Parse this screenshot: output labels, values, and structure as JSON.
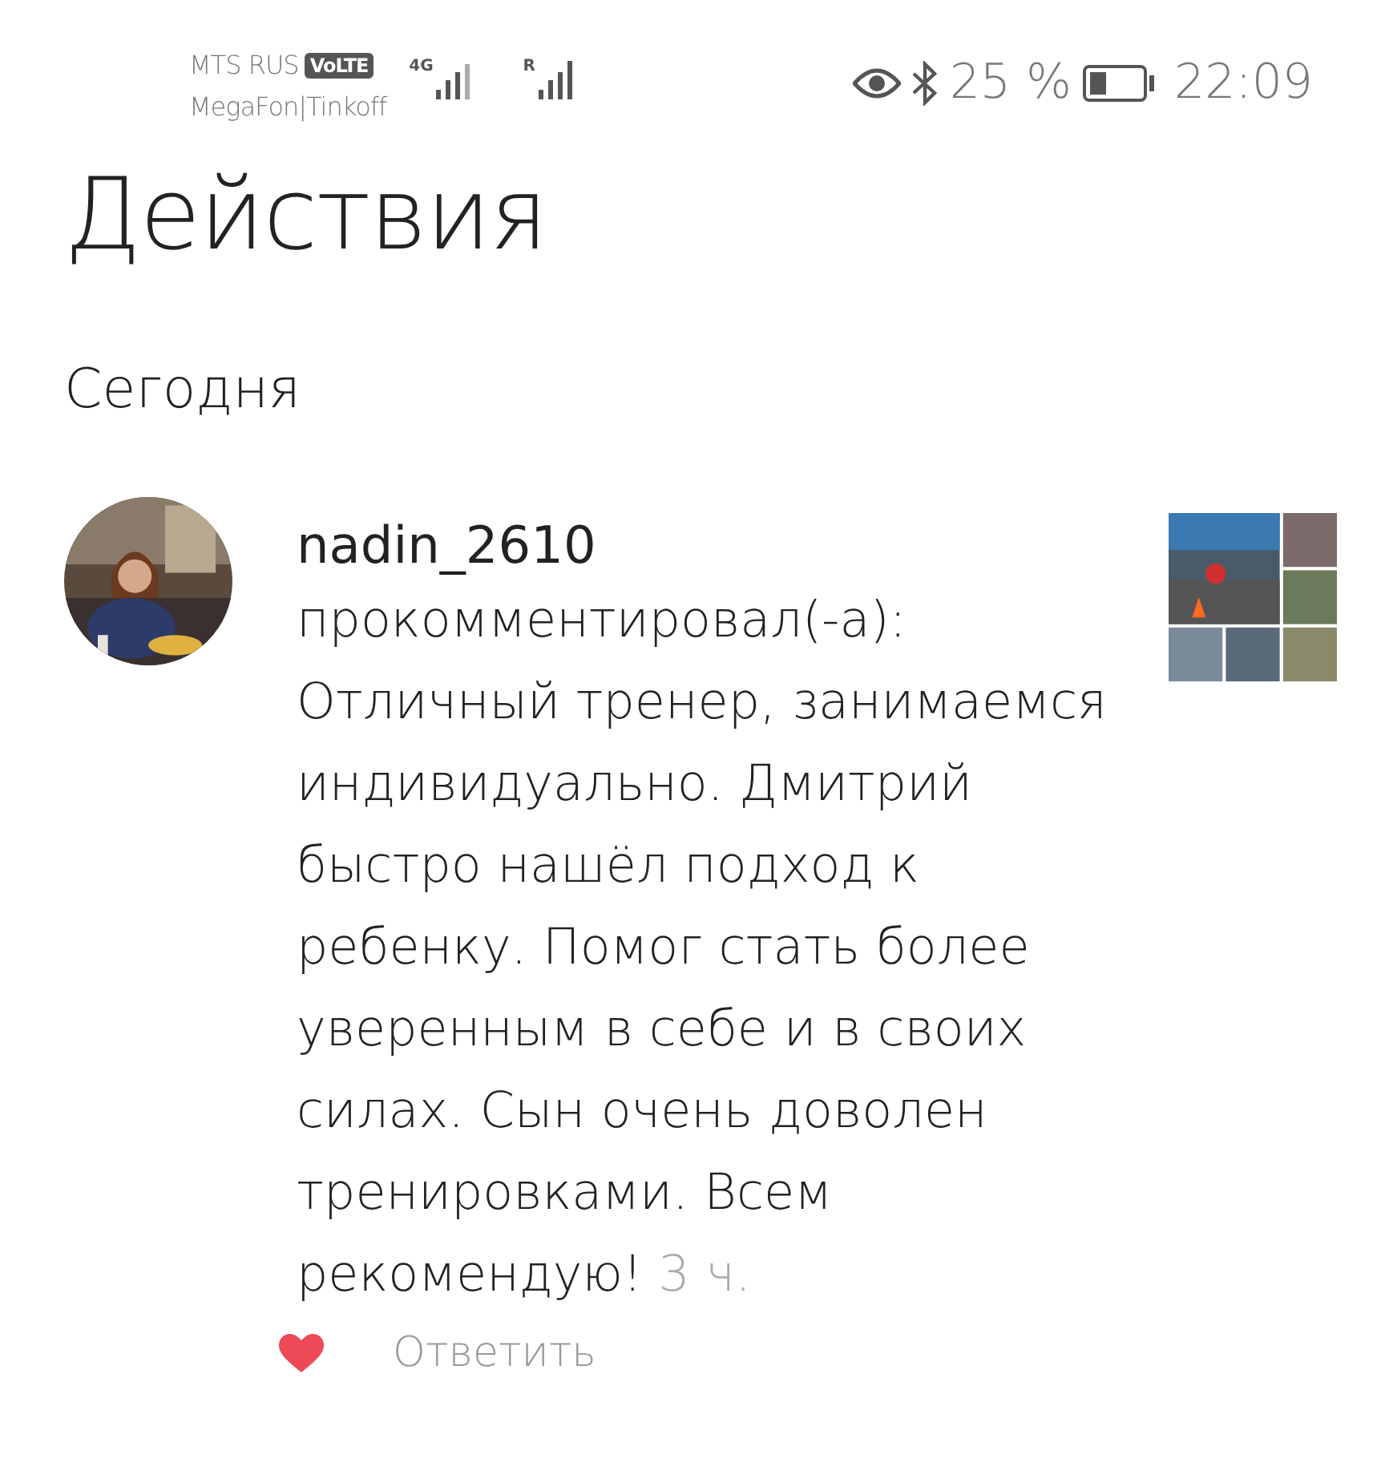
{
  "status_bar": {
    "carrier_1": "MTS RUS",
    "volte_badge": "VoLTE",
    "carrier_2": "MegaFon|Tinkoff",
    "network_1": "4G",
    "network_2": "R",
    "battery_percent": "25 %",
    "time": "22:09"
  },
  "title": "Действия",
  "section": "Сегодня",
  "activity": {
    "username": "nadin_2610",
    "action": "прокомментировал(-а):",
    "comment": "Отличный тренер, занимаемся индивидуально. Дмитрий быстро нашёл подход к ребенку. Помог стать более уверенным в себе и в своих силах. Сын очень доволен тренировками. Всем рекомендую!",
    "time": "3 ч.",
    "liked": true,
    "reply_label": "Ответить"
  }
}
